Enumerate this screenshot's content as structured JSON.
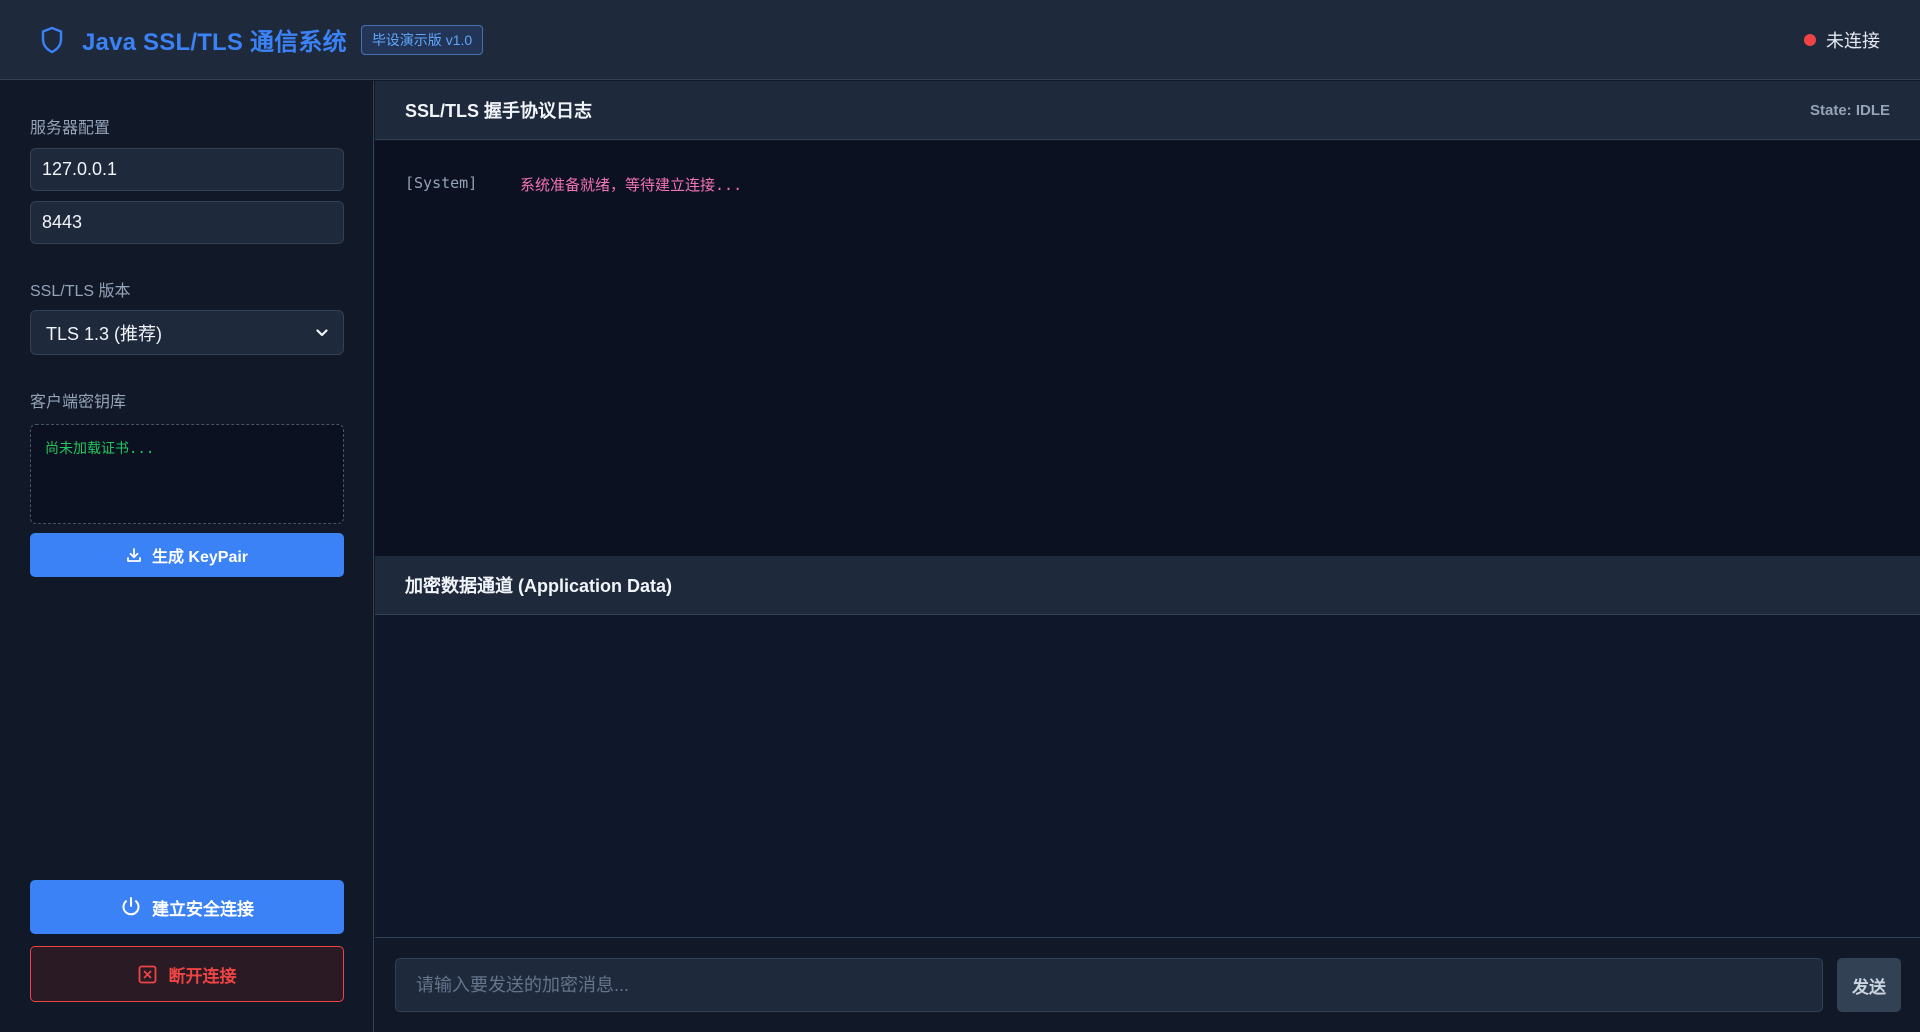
{
  "header": {
    "title": "Java SSL/TLS 通信系统",
    "badge": "毕设演示版 v1.0",
    "status": "未连接"
  },
  "colors": {
    "accent": "#3b82f6",
    "danger": "#ef4444",
    "log_message": "#f472b6",
    "keystore_text": "#22c55e"
  },
  "sidebar": {
    "server_label": "服务器配置",
    "host_value": "127.0.0.1",
    "port_value": "8443",
    "version_label": "SSL/TLS 版本",
    "version_selected": "TLS 1.3 (推荐)",
    "keystore_label": "客户端密钥库",
    "keystore_text": "尚未加载证书...",
    "gen_keypair_label": "生成 KeyPair",
    "connect_label": "建立安全连接",
    "disconnect_label": "断开连接"
  },
  "log_panel": {
    "title": "SSL/TLS 握手协议日志",
    "state": "State: IDLE",
    "entries": [
      {
        "tag": "[System]",
        "message": "系统准备就绪，等待建立连接..."
      }
    ]
  },
  "data_panel": {
    "title": "加密数据通道 (Application Data)"
  },
  "composer": {
    "placeholder": "请输入要发送的加密消息...",
    "send_label": "发送"
  },
  "icons": {
    "logo": "shield-icon",
    "keypair": "download-icon",
    "connect": "power-icon",
    "disconnect": "close-box-icon",
    "select": "chevron-down-icon"
  }
}
